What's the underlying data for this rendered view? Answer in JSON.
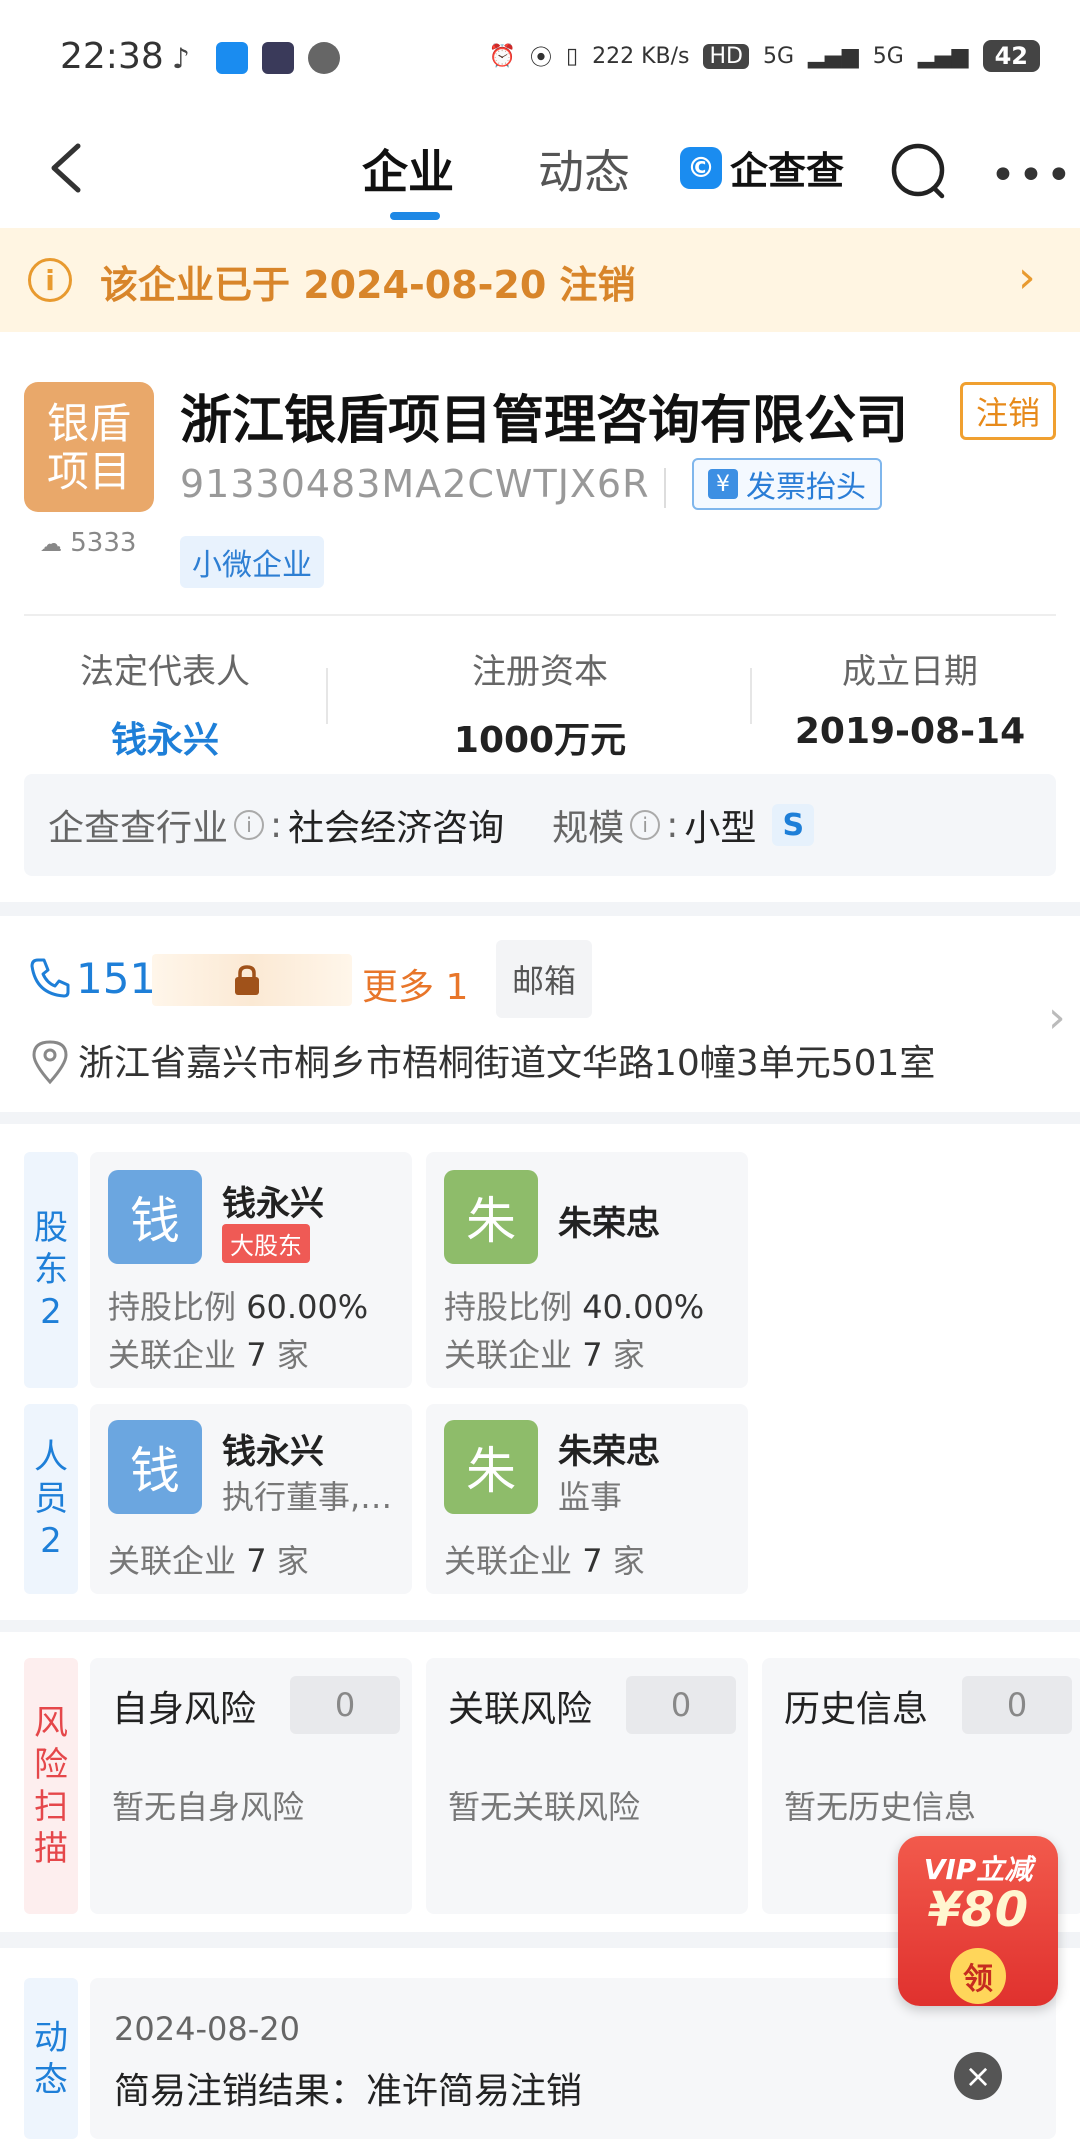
{
  "status_bar": {
    "time": "22:38",
    "net_speed": "222 KB/s",
    "hd_label": "HD",
    "network_1": "5G",
    "network_2": "5G",
    "battery": "42"
  },
  "nav": {
    "tabs": [
      {
        "label": "企业"
      },
      {
        "label": "动态"
      }
    ],
    "brand": "企查查"
  },
  "banner": {
    "text": "该企业已于 2024-08-20 注销"
  },
  "company": {
    "logo_text_line1": "银盾",
    "logo_text_line2": "项目",
    "heat_count": "5333",
    "name": "浙江银盾项目管理咨询有限公司",
    "status": "注销",
    "credit_code": "91330483MA2CWTJX6R",
    "invoice_label": "发票抬头",
    "size_tag": "小微企业",
    "key_info": [
      {
        "label": "法定代表人",
        "value": "钱永兴"
      },
      {
        "label": "注册资本",
        "value": "1000万元"
      },
      {
        "label": "成立日期",
        "value": "2019-08-14"
      }
    ],
    "industry_label": "企查查行业",
    "industry_value": "社会经济咨询",
    "scale_label": "规模",
    "scale_value": "小型",
    "scale_badge": "S"
  },
  "contact": {
    "phone_prefix": "151",
    "more_phones": "更多 1",
    "email_label": "邮箱",
    "address": "浙江省嘉兴市桐乡市梧桐街道文华路10幢3单元501室"
  },
  "shareholders": {
    "tab_line1": "股",
    "tab_line2": "东",
    "count": "2",
    "items": [
      {
        "avatar": "钱",
        "name": "钱永兴",
        "tag": "大股东",
        "ratio_label": "持股比例",
        "ratio": "60.00%",
        "related_label": "关联企业",
        "related": "7",
        "unit": "家"
      },
      {
        "avatar": "朱",
        "name": "朱荣忠",
        "ratio_label": "持股比例",
        "ratio": "40.00%",
        "related_label": "关联企业",
        "related": "7",
        "unit": "家"
      }
    ]
  },
  "personnel": {
    "tab_line1": "人",
    "tab_line2": "员",
    "count": "2",
    "items": [
      {
        "avatar": "钱",
        "name": "钱永兴",
        "role": "执行董事,…",
        "related_label": "关联企业",
        "related": "7",
        "unit": "家"
      },
      {
        "avatar": "朱",
        "name": "朱荣忠",
        "role": "监事",
        "related_label": "关联企业",
        "related": "7",
        "unit": "家"
      }
    ]
  },
  "risk": {
    "tab": [
      "风",
      "险",
      "扫",
      "描"
    ],
    "items": [
      {
        "title": "自身风险",
        "count": "0",
        "desc": "暂无自身风险"
      },
      {
        "title": "关联风险",
        "count": "0",
        "desc": "暂无关联风险"
      },
      {
        "title": "历史信息",
        "count": "0",
        "desc": "暂无历史信息"
      }
    ]
  },
  "dynamic": {
    "tab_line1": "动",
    "tab_line2": "态",
    "date": "2024-08-20",
    "text": "简易注销结果：准许简易注销"
  },
  "vip": {
    "title": "VIP立减",
    "amount": "¥80",
    "button": "领"
  },
  "colors": {
    "accent": "#1e7fd8",
    "warning": "#d8852a",
    "danger": "#e5474a"
  }
}
